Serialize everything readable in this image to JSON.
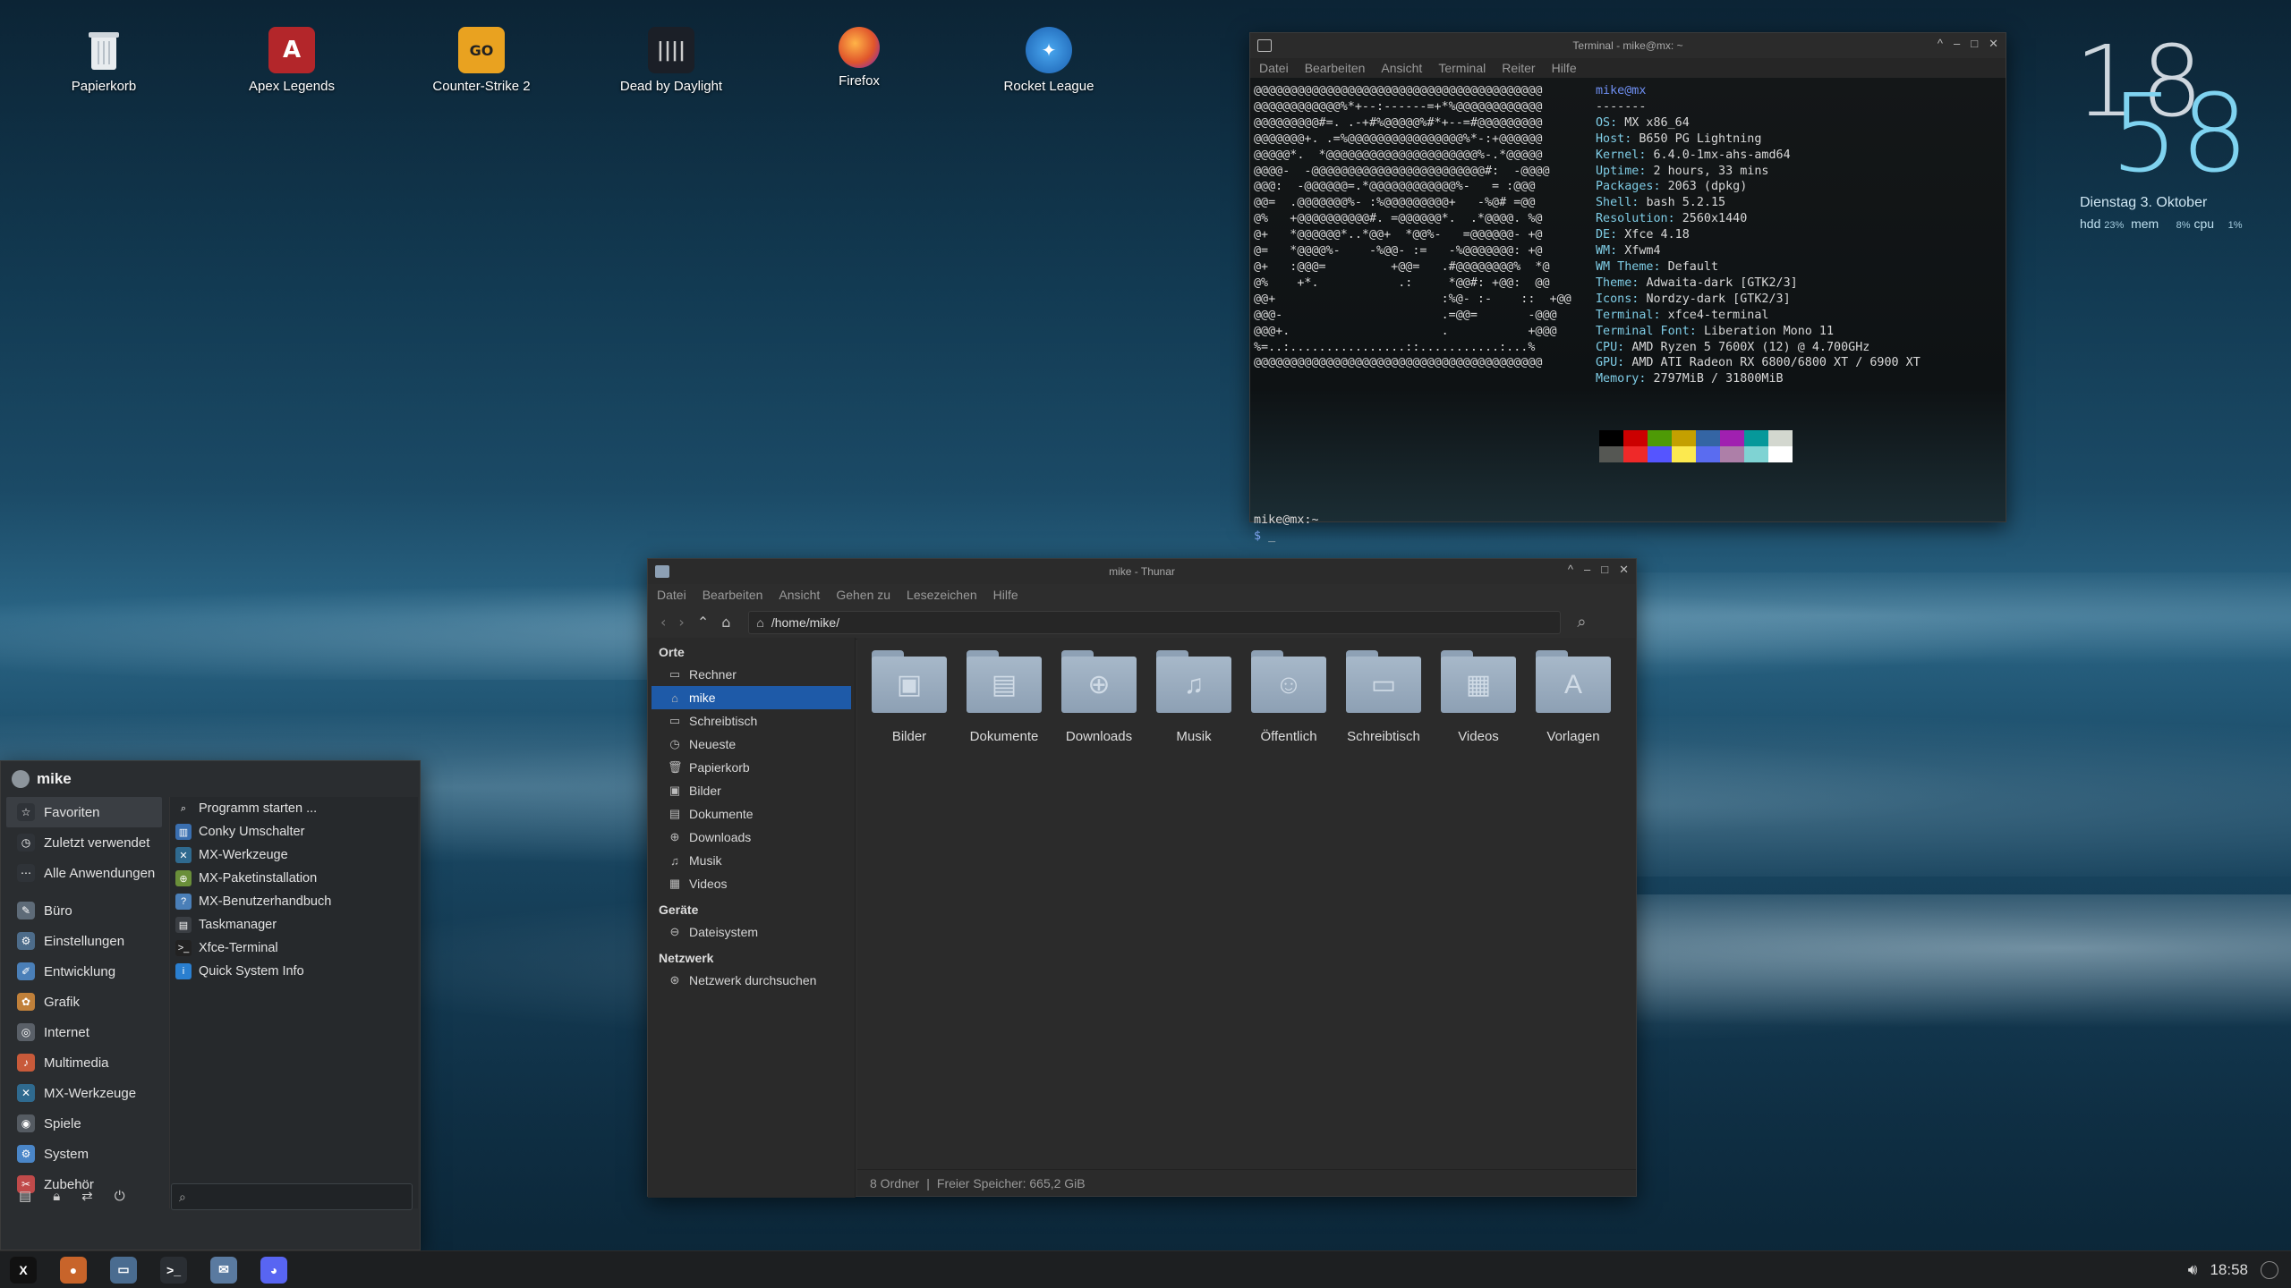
{
  "desktop": {
    "icons": [
      {
        "label": "Papierkorb",
        "icon": "trash-icon"
      },
      {
        "label": "Apex Legends",
        "icon": "apex-legends-icon"
      },
      {
        "label": "Counter-Strike 2",
        "icon": "counter-strike-icon"
      },
      {
        "label": "Dead by Daylight",
        "icon": "dead-by-daylight-icon"
      },
      {
        "label": "Firefox",
        "icon": "firefox-icon"
      },
      {
        "label": "Rocket League",
        "icon": "rocket-league-icon"
      }
    ]
  },
  "clock": {
    "hours": "18",
    "minutes": "58",
    "date": "Dienstag  3. Oktober",
    "hdd_label": "hdd",
    "hdd_value": "23%",
    "mem_label": "mem",
    "mem_value": "8%",
    "cpu_label": "cpu",
    "cpu_value": "1%"
  },
  "terminal": {
    "title": "Terminal - mike@mx: ~",
    "menu": [
      "Datei",
      "Bearbeiten",
      "Ansicht",
      "Terminal",
      "Reiter",
      "Hilfe"
    ],
    "ascii_art": [
      "@@@@@@@@@@@@@@@@@@@@@@@@@@@@@@@@@@@@@@@@",
      "@@@@@@@@@@@@%*+--:------=+*%@@@@@@@@@@@@",
      "@@@@@@@@@#=. .-+#%@@@@@%#*+--=#@@@@@@@@@",
      "@@@@@@@+. .=%@@@@@@@@@@@@@@@@%*-:+@@@@@@",
      "@@@@@*.  *@@@@@@@@@@@@@@@@@@@@@%-.*@@@@@",
      "@@@@-  -@@@@@@@@@@@@@@@@@@@@@@@@#:  -@@@@",
      "@@@:  -@@@@@@=.*@@@@@@@@@@@@%-   = :@@@",
      "@@=  .@@@@@@@%- :%@@@@@@@@@+   -%@# =@@",
      "@%   +@@@@@@@@@@#. =@@@@@@*.  .*@@@@. %@",
      "@+   *@@@@@@*..*@@+  *@@%-   =@@@@@@- +@",
      "@=   *@@@@%-    -%@@- :=   -%@@@@@@@: +@",
      "@+   :@@@=         +@@=   .#@@@@@@@@%  *@",
      "@%    +*.           .:     *@@#: +@@:  @@",
      "@@+                       :%@- :-    ::  +@@",
      "@@@-                      .=@@=       -@@@",
      "@@@+.                     .           +@@@",
      "%=..:................::...........:...%",
      "@@@@@@@@@@@@@@@@@@@@@@@@@@@@@@@@@@@@@@@@"
    ],
    "user_host": "mike@mx",
    "separator": "-------",
    "info": [
      {
        "key": "OS",
        "value": "MX x86_64"
      },
      {
        "key": "Host",
        "value": "B650 PG Lightning"
      },
      {
        "key": "Kernel",
        "value": "6.4.0-1mx-ahs-amd64"
      },
      {
        "key": "Uptime",
        "value": "2 hours, 33 mins"
      },
      {
        "key": "Packages",
        "value": "2063 (dpkg)"
      },
      {
        "key": "Shell",
        "value": "bash 5.2.15"
      },
      {
        "key": "Resolution",
        "value": "2560x1440"
      },
      {
        "key": "DE",
        "value": "Xfce 4.18"
      },
      {
        "key": "WM",
        "value": "Xfwm4"
      },
      {
        "key": "WM Theme",
        "value": "Default"
      },
      {
        "key": "Theme",
        "value": "Adwaita-dark [GTK2/3]"
      },
      {
        "key": "Icons",
        "value": "Nordzy-dark [GTK2/3]"
      },
      {
        "key": "Terminal",
        "value": "xfce4-terminal"
      },
      {
        "key": "Terminal Font",
        "value": "Liberation Mono 11"
      },
      {
        "key": "CPU",
        "value": "AMD Ryzen 5 7600X (12) @ 4.700GHz"
      },
      {
        "key": "GPU",
        "value": "AMD ATI Radeon RX 6800/6800 XT / 6900 XT"
      },
      {
        "key": "Memory",
        "value": "2797MiB / 31800MiB"
      }
    ],
    "palette_top": [
      "#000000",
      "#cc0000",
      "#4e9a06",
      "#c4a000",
      "#3465a4",
      "#a020b0",
      "#06989a",
      "#d3d7cf"
    ],
    "palette_bottom": [
      "#555753",
      "#ef2929",
      "#5555ff",
      "#fce94f",
      "#5a6cf0",
      "#ad7fa8",
      "#7fd3d3",
      "#ffffff"
    ],
    "prompt": "mike@mx:~",
    "prompt_symbol": "$",
    "cursor": "_"
  },
  "thunar": {
    "title": "mike - Thunar",
    "menu": [
      "Datei",
      "Bearbeiten",
      "Ansicht",
      "Gehen zu",
      "Lesezeichen",
      "Hilfe"
    ],
    "path": "/home/mike/",
    "sidebar": [
      {
        "section": "Orte",
        "items": [
          {
            "label": "Rechner",
            "icon": "computer-icon",
            "selected": false
          },
          {
            "label": "mike",
            "icon": "home-icon",
            "selected": true
          },
          {
            "label": "Schreibtisch",
            "icon": "desktop-icon",
            "selected": false
          },
          {
            "label": "Neueste",
            "icon": "clock-icon",
            "selected": false
          },
          {
            "label": "Papierkorb",
            "icon": "trash-icon",
            "selected": false
          },
          {
            "label": "Bilder",
            "icon": "image-icon",
            "selected": false
          },
          {
            "label": "Dokumente",
            "icon": "document-icon",
            "selected": false
          },
          {
            "label": "Downloads",
            "icon": "download-icon",
            "selected": false
          },
          {
            "label": "Musik",
            "icon": "music-icon",
            "selected": false
          },
          {
            "label": "Videos",
            "icon": "video-icon",
            "selected": false
          }
        ]
      },
      {
        "section": "Geräte",
        "items": [
          {
            "label": "Dateisystem",
            "icon": "drive-icon",
            "selected": false
          }
        ]
      },
      {
        "section": "Netzwerk",
        "items": [
          {
            "label": "Netzwerk durchsuchen",
            "icon": "network-icon",
            "selected": false
          }
        ]
      }
    ],
    "folders": [
      {
        "name": "Bilder",
        "icon": "image-icon"
      },
      {
        "name": "Dokumente",
        "icon": "document-icon"
      },
      {
        "name": "Downloads",
        "icon": "download-icon"
      },
      {
        "name": "Musik",
        "icon": "music-icon"
      },
      {
        "name": "Öffentlich",
        "icon": "people-icon"
      },
      {
        "name": "Schreibtisch",
        "icon": "desktop-icon"
      },
      {
        "name": "Videos",
        "icon": "video-icon"
      },
      {
        "name": "Vorlagen",
        "icon": "template-icon"
      }
    ],
    "status_count": "8 Ordner",
    "status_sep": "|",
    "status_free": "Freier Speicher: 665,2 GiB"
  },
  "whisker": {
    "user": "mike",
    "categories": [
      {
        "label": "Favoriten",
        "icon": "star-icon",
        "color": "#2f3338",
        "selected": true
      },
      {
        "label": "Zuletzt verwendet",
        "icon": "clock-icon",
        "color": "#2f3338",
        "selected": false
      },
      {
        "label": "Alle Anwendungen",
        "icon": "apps-icon",
        "color": "#2f3338",
        "selected": false
      },
      {
        "label": "Büro",
        "icon": "office-icon",
        "color": "#5e6b78",
        "selected": false
      },
      {
        "label": "Einstellungen",
        "icon": "settings-icon",
        "color": "#4d6c8a",
        "selected": false
      },
      {
        "label": "Entwicklung",
        "icon": "development-icon",
        "color": "#4a7fb8",
        "selected": false
      },
      {
        "label": "Grafik",
        "icon": "graphics-icon",
        "color": "#c0803a",
        "selected": false
      },
      {
        "label": "Internet",
        "icon": "internet-icon",
        "color": "#5a6068",
        "selected": false
      },
      {
        "label": "Multimedia",
        "icon": "multimedia-icon",
        "color": "#c85a3a",
        "selected": false
      },
      {
        "label": "MX-Werkzeuge",
        "icon": "mx-tools-icon",
        "color": "#2f6a8f",
        "selected": false
      },
      {
        "label": "Spiele",
        "icon": "games-icon",
        "color": "#555b62",
        "selected": false
      },
      {
        "label": "System",
        "icon": "system-icon",
        "color": "#4a86c8",
        "selected": false
      },
      {
        "label": "Zubehör",
        "icon": "accessories-icon",
        "color": "#c04a4a",
        "selected": false
      }
    ],
    "apps": [
      {
        "label": "Programm starten ...",
        "icon": "search-icon",
        "color": "#26292c"
      },
      {
        "label": "Conky Umschalter",
        "icon": "conky-icon",
        "color": "#3a6fb0"
      },
      {
        "label": "MX-Werkzeuge",
        "icon": "mx-tools-icon",
        "color": "#2f6a8f"
      },
      {
        "label": "MX-Paketinstallation",
        "icon": "package-icon",
        "color": "#6a8f3a"
      },
      {
        "label": "MX-Benutzerhandbuch",
        "icon": "manual-icon",
        "color": "#4a7fb8"
      },
      {
        "label": "Taskmanager",
        "icon": "taskmanager-icon",
        "color": "#3a3e43"
      },
      {
        "label": "Xfce-Terminal",
        "icon": "terminal-icon",
        "color": "#222"
      },
      {
        "label": "Quick System Info",
        "icon": "info-icon",
        "color": "#2a7fd0"
      }
    ],
    "footer_icons": [
      "settings-manager-icon",
      "lock-icon",
      "switch-user-icon",
      "power-icon"
    ]
  },
  "taskbar": {
    "buttons": [
      {
        "icon": "mx-logo-icon",
        "color": "#111111"
      },
      {
        "icon": "firefox-icon",
        "color": "#c8642a"
      },
      {
        "icon": "file-manager-icon",
        "color": "#4a6c90"
      },
      {
        "icon": "terminal-icon",
        "color": "#2a2e33"
      },
      {
        "icon": "mail-icon",
        "color": "#5a7aa0"
      },
      {
        "icon": "discord-icon",
        "color": "#5865f2"
      }
    ],
    "time": "18:58"
  }
}
